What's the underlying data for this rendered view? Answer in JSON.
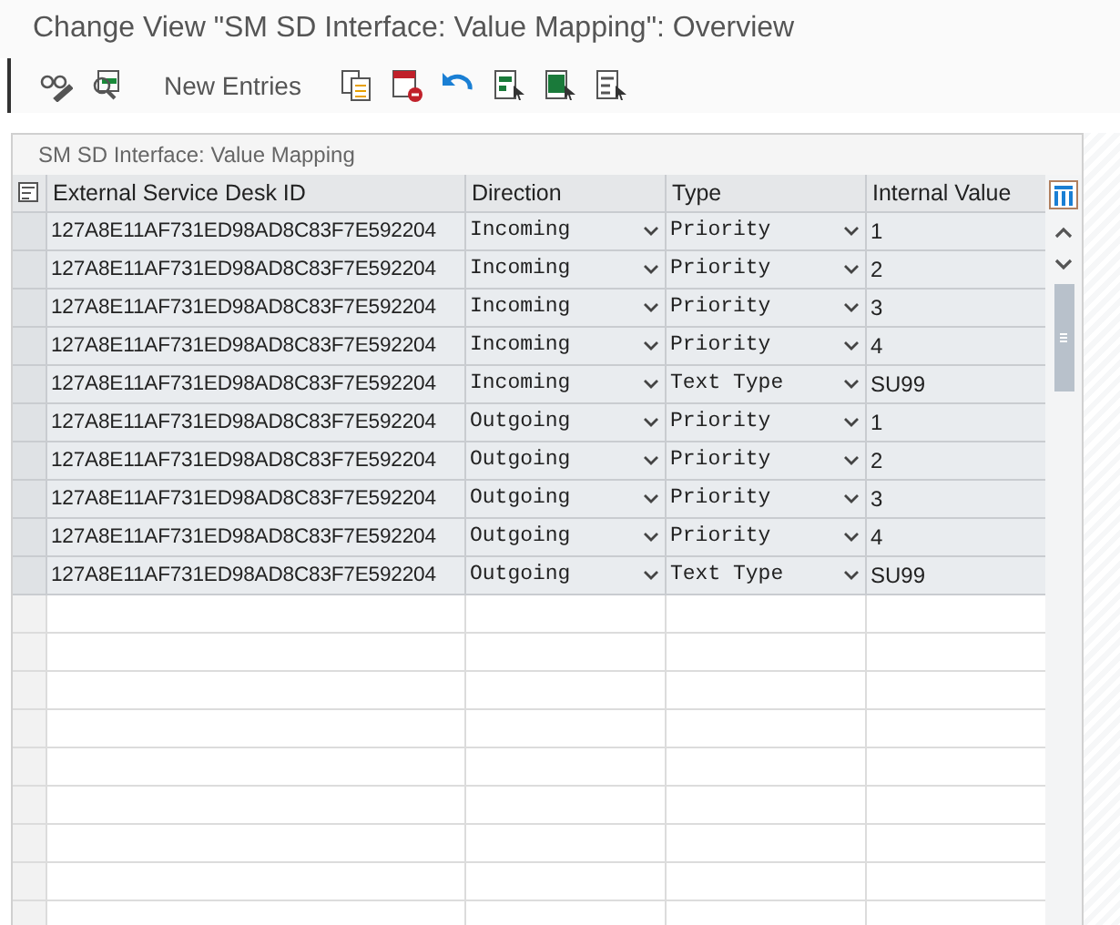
{
  "window": {
    "title": "Change View \"SM SD Interface: Value Mapping\": Overview"
  },
  "toolbar": {
    "new_entries": "New Entries"
  },
  "table": {
    "title": "SM SD Interface: Value Mapping",
    "columns": [
      "External Service Desk ID",
      "Direction",
      "Type",
      "Internal Value"
    ],
    "rows": [
      {
        "external_id": "127A8E11AF731ED98AD8C83F7E592204",
        "direction": "Incoming",
        "type": "Priority",
        "internal_value": "1"
      },
      {
        "external_id": "127A8E11AF731ED98AD8C83F7E592204",
        "direction": "Incoming",
        "type": "Priority",
        "internal_value": "2"
      },
      {
        "external_id": "127A8E11AF731ED98AD8C83F7E592204",
        "direction": "Incoming",
        "type": "Priority",
        "internal_value": "3"
      },
      {
        "external_id": "127A8E11AF731ED98AD8C83F7E592204",
        "direction": "Incoming",
        "type": "Priority",
        "internal_value": "4"
      },
      {
        "external_id": "127A8E11AF731ED98AD8C83F7E592204",
        "direction": "Incoming",
        "type": "Text Type",
        "internal_value": "SU99"
      },
      {
        "external_id": "127A8E11AF731ED98AD8C83F7E592204",
        "direction": "Outgoing",
        "type": "Priority",
        "internal_value": "1"
      },
      {
        "external_id": "127A8E11AF731ED98AD8C83F7E592204",
        "direction": "Outgoing",
        "type": "Priority",
        "internal_value": "2"
      },
      {
        "external_id": "127A8E11AF731ED98AD8C83F7E592204",
        "direction": "Outgoing",
        "type": "Priority",
        "internal_value": "3"
      },
      {
        "external_id": "127A8E11AF731ED98AD8C83F7E592204",
        "direction": "Outgoing",
        "type": "Priority",
        "internal_value": "4"
      },
      {
        "external_id": "127A8E11AF731ED98AD8C83F7E592204",
        "direction": "Outgoing",
        "type": "Text Type",
        "internal_value": "SU99"
      }
    ]
  }
}
